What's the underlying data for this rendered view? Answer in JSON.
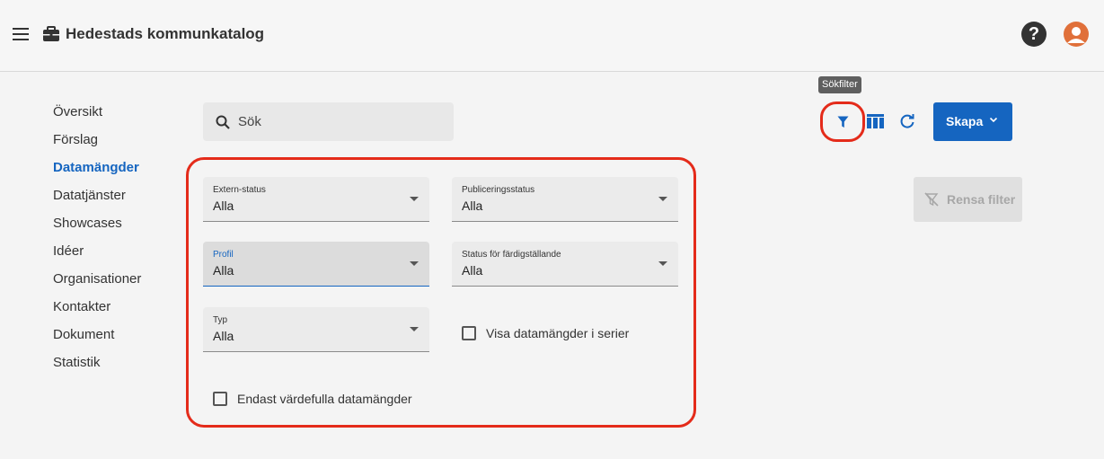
{
  "header": {
    "title": "Hedestads kommunkatalog",
    "help_symbol": "?"
  },
  "sidebar": {
    "items": [
      {
        "label": "Översikt"
      },
      {
        "label": "Förslag"
      },
      {
        "label": "Datamängder",
        "active": true
      },
      {
        "label": "Datatjänster"
      },
      {
        "label": "Showcases"
      },
      {
        "label": "Idéer"
      },
      {
        "label": "Organisationer"
      },
      {
        "label": "Kontakter"
      },
      {
        "label": "Dokument"
      },
      {
        "label": "Statistik"
      }
    ]
  },
  "search": {
    "placeholder": "Sök",
    "value": ""
  },
  "toolbar": {
    "filter_tooltip": "Sökfilter",
    "create_label": "Skapa",
    "clear_filter_label": "Rensa filter"
  },
  "filters": {
    "extern_status": {
      "label": "Extern-status",
      "value": "Alla"
    },
    "publiceringsstatus": {
      "label": "Publiceringsstatus",
      "value": "Alla"
    },
    "profil": {
      "label": "Profil",
      "value": "Alla"
    },
    "status_fardig": {
      "label": "Status för färdigställande",
      "value": "Alla"
    },
    "typ": {
      "label": "Typ",
      "value": "Alla"
    },
    "visa_serier": {
      "label": "Visa datamängder i serier",
      "checked": false
    },
    "endast_vardefulla": {
      "label": "Endast värdefulla datamängder",
      "checked": false
    }
  },
  "colors": {
    "accent": "#1565c0",
    "highlight": "#e42b1a",
    "avatar": "#e0703a"
  },
  "icons": [
    "menu-icon",
    "briefcase-icon",
    "help-icon",
    "avatar-icon",
    "search-icon",
    "filter-icon",
    "columns-icon",
    "refresh-icon",
    "chevron-down-icon",
    "clear-filter-icon"
  ]
}
